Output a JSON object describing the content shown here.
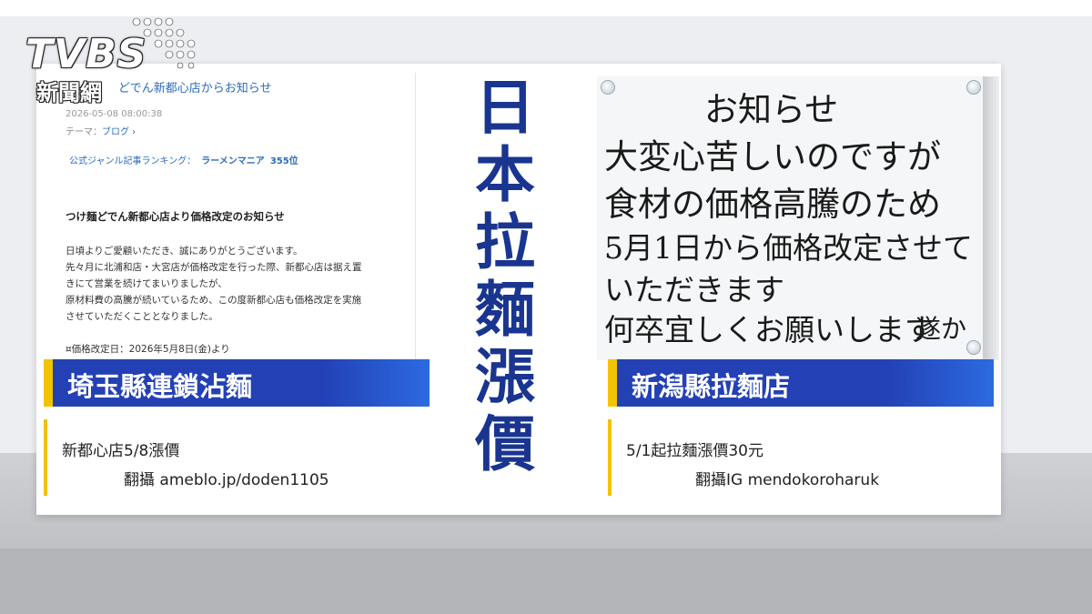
{
  "logo": {
    "main": "TVBS",
    "sub": "新聞網"
  },
  "headline": "日本拉麵漲價",
  "left_panel": {
    "blog": {
      "title": "どでん新都心店からお知らせ",
      "date": "2026-05-08 08:00:38",
      "theme_label": "テーマ：",
      "theme_value": "ブログ",
      "rank_label": "公式ジャンル記事ランキング：",
      "rank_genre": "ラーメンマニア",
      "rank_value": "355位",
      "heading": "つけ麺どでん新都心店より価格改定のお知らせ",
      "body_lines": [
        "日頃よりご愛顧いただき、誠にありがとうございます。",
        "先々月に北浦和店・大宮店が価格改定を行った際、新都心店は据え置",
        "きにて営業を続けてまいりましたが、",
        "原材料費の高騰が続いているため、この度新都心店も価格改定を実施",
        "させていただくこととなりました。"
      ],
      "date_line": "¤価格改定日：2026年5月8日(金)より"
    },
    "banner": "埼玉縣連鎖沾麵",
    "caption_line1": "新都心店5/8漲價",
    "caption_line2": "翻攝 ameblo.jp/doden1105"
  },
  "right_panel": {
    "sign_lines": [
      "お知らせ",
      "大変心苦しいのですが",
      "食材の価格高騰のため",
      "5月1日から価格改定させて",
      "いただきます",
      "何卒宜しくお願いします"
    ],
    "sign_signature": "遂か",
    "banner": "新潟縣拉麵店",
    "caption_line1": "5/1起拉麵漲價30元",
    "caption_line2": "翻攝IG mendokoroharuk"
  },
  "colors": {
    "banner_blue": "#2340b5",
    "accent_yellow": "#f2c300",
    "headline_blue": "#1a3590"
  }
}
